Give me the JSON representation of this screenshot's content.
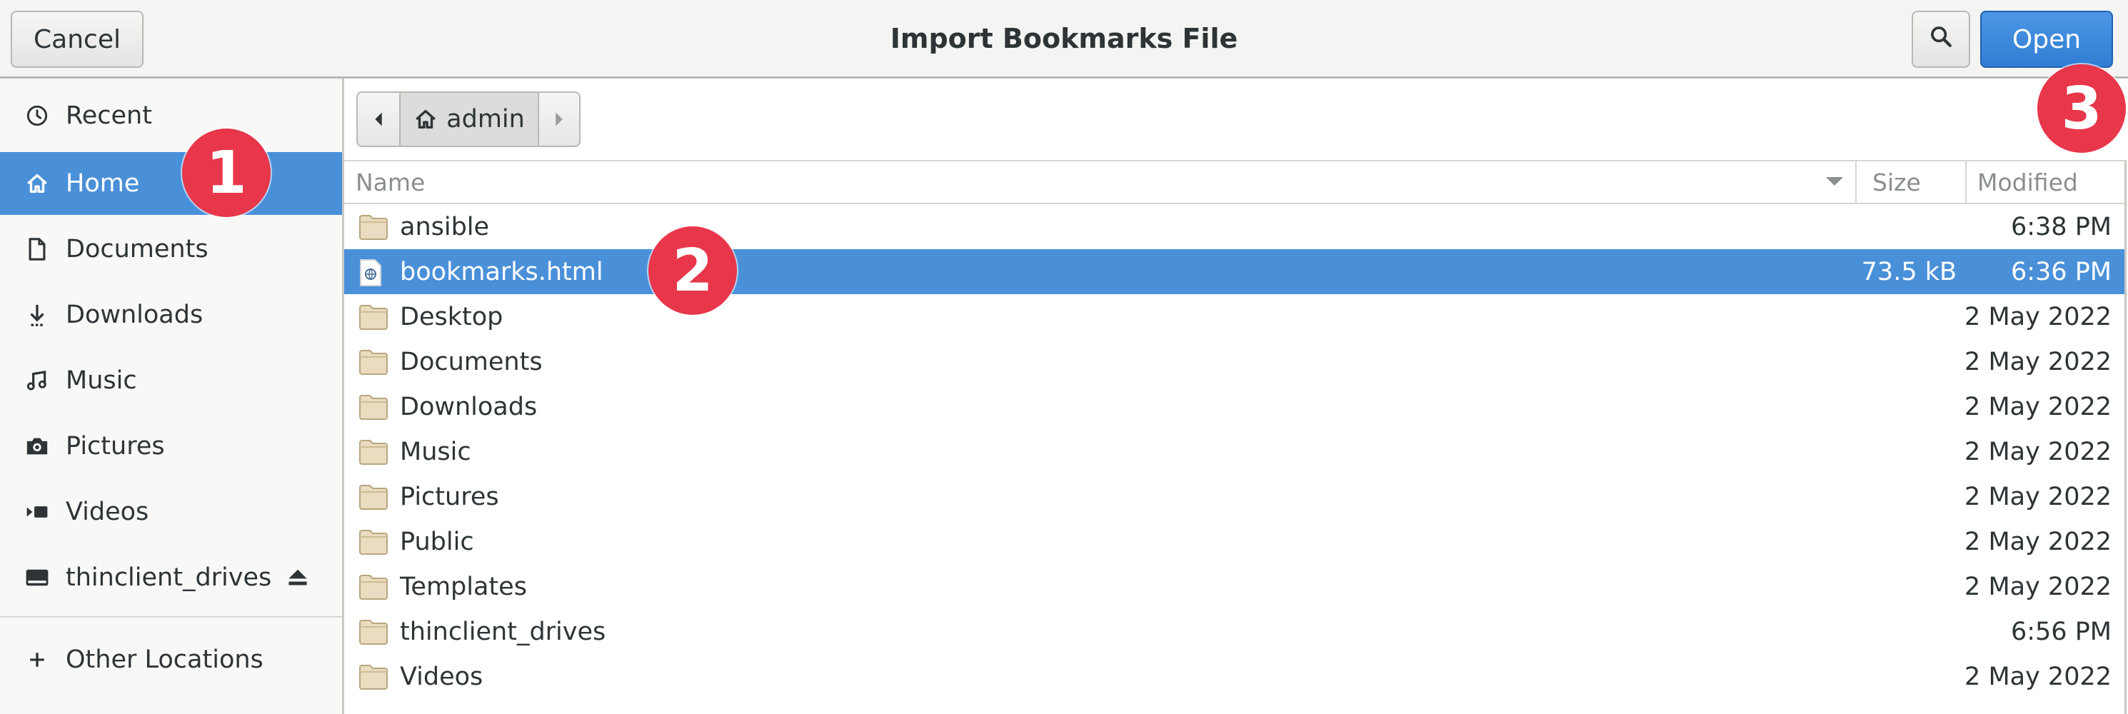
{
  "window": {
    "title": "Import Bookmarks File",
    "cancel_label": "Cancel",
    "open_label": "Open",
    "search_icon": "search-icon"
  },
  "sidebar": {
    "items": [
      {
        "label": "Recent",
        "icon": "clock-icon"
      },
      {
        "label": "Home",
        "icon": "home-icon",
        "selected": true
      },
      {
        "label": "Documents",
        "icon": "document-icon"
      },
      {
        "label": "Downloads",
        "icon": "download-icon"
      },
      {
        "label": "Music",
        "icon": "music-icon"
      },
      {
        "label": "Pictures",
        "icon": "camera-icon"
      },
      {
        "label": "Videos",
        "icon": "video-icon"
      },
      {
        "label": "thinclient_drives",
        "icon": "drive-icon",
        "eject_icon": "eject-icon"
      }
    ],
    "other_locations": "Other Locations"
  },
  "pathbar": {
    "current": "admin"
  },
  "columns": {
    "name": "Name",
    "size": "Size",
    "modified": "Modified"
  },
  "files": [
    {
      "name": "ansible",
      "size": "",
      "modified": "6:38 PM",
      "type": "folder"
    },
    {
      "name": "bookmarks.html",
      "size": "73.5 kB",
      "modified": "6:36 PM",
      "type": "html",
      "selected": true
    },
    {
      "name": "Desktop",
      "size": "",
      "modified": "2 May 2022",
      "type": "folder"
    },
    {
      "name": "Documents",
      "size": "",
      "modified": "2 May 2022",
      "type": "folder"
    },
    {
      "name": "Downloads",
      "size": "",
      "modified": "2 May 2022",
      "type": "folder"
    },
    {
      "name": "Music",
      "size": "",
      "modified": "2 May 2022",
      "type": "folder"
    },
    {
      "name": "Pictures",
      "size": "",
      "modified": "2 May 2022",
      "type": "folder"
    },
    {
      "name": "Public",
      "size": "",
      "modified": "2 May 2022",
      "type": "folder"
    },
    {
      "name": "Templates",
      "size": "",
      "modified": "2 May 2022",
      "type": "folder"
    },
    {
      "name": "thinclient_drives",
      "size": "",
      "modified": "6:56 PM",
      "type": "folder"
    },
    {
      "name": "Videos",
      "size": "",
      "modified": "2 May 2022",
      "type": "folder"
    }
  ],
  "badges": [
    "1",
    "2",
    "3"
  ],
  "colors": {
    "selection": "#4a90d9",
    "open_button": "#3584e4",
    "badge": "#e8364a",
    "folder": "#e9dcc0"
  }
}
